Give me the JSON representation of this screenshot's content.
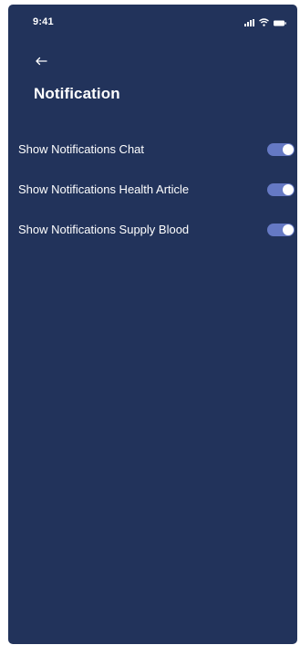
{
  "status_bar": {
    "time": "9:41",
    "icons": [
      "signal-icon",
      "wifi-icon",
      "battery-icon"
    ]
  },
  "header": {
    "back_icon": "back-arrow-icon",
    "title": "Notification"
  },
  "settings": [
    {
      "label": "Show Notifications Chat",
      "enabled": true
    },
    {
      "label": "Show Notifications Health Article",
      "enabled": true
    },
    {
      "label": "Show Notifications Supply Blood",
      "enabled": true
    }
  ],
  "colors": {
    "background": "#22335b",
    "toggle_track": "#6579c4",
    "toggle_knob": "#ffffff",
    "text": "#ffffff"
  }
}
